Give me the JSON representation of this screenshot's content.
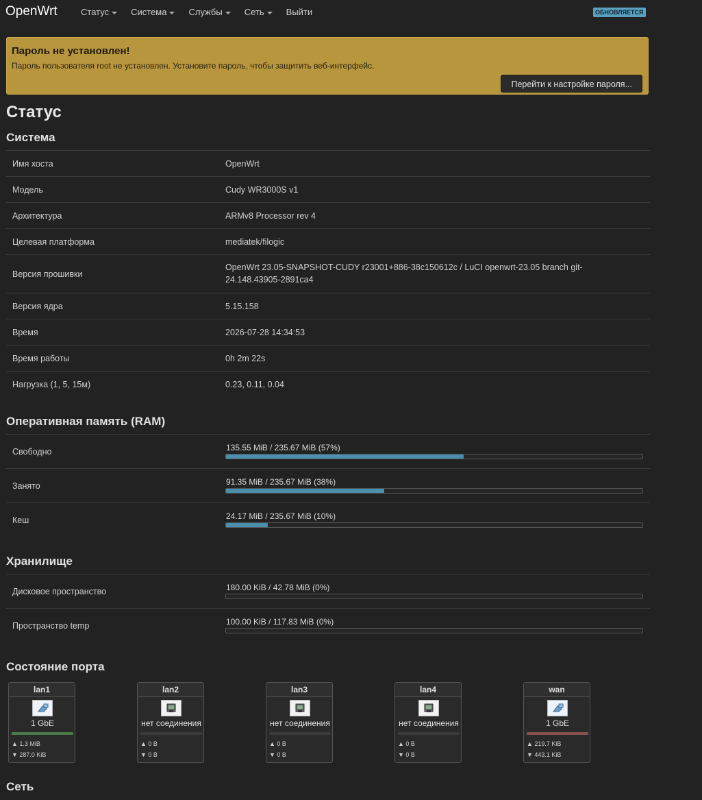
{
  "header": {
    "brand": "OpenWrt",
    "nav": [
      "Статус",
      "Система",
      "Службы",
      "Сеть",
      "Выйти"
    ],
    "badge": "ОБНОВЛЯЕТСЯ"
  },
  "alert": {
    "title": "Пароль не установлен!",
    "text": "Пароль пользователя root не установлен. Установите пароль, чтобы защитить веб-интерфейс.",
    "button": "Перейти к настройке пароля..."
  },
  "page_title": "Статус",
  "system": {
    "title": "Система",
    "rows": [
      {
        "k": "Имя хоста",
        "v": "OpenWrt"
      },
      {
        "k": "Модель",
        "v": "Cudy WR3000S v1"
      },
      {
        "k": "Архитектура",
        "v": "ARMv8 Processor rev 4"
      },
      {
        "k": "Целевая платформа",
        "v": "mediatek/filogic"
      },
      {
        "k": "Версия прошивки",
        "v": "OpenWrt 23.05-SNAPSHOT-CUDY r23001+886-38c150612c / LuCI openwrt-23.05 branch git-24.148.43905-2891ca4"
      },
      {
        "k": "Версия ядра",
        "v": "5.15.158"
      },
      {
        "k": "Время",
        "v": "2026-07-28 14:34:53"
      },
      {
        "k": "Время работы",
        "v": "0h 2m 22s"
      },
      {
        "k": "Нагрузка (1, 5, 15м)",
        "v": "0.23, 0.11, 0.04"
      }
    ]
  },
  "ram": {
    "title": "Оперативная память (RAM)",
    "rows": [
      {
        "k": "Свободно",
        "label": "135.55 MiB / 235.67 MiB (57%)",
        "pct": 57
      },
      {
        "k": "Занято",
        "label": "91.35 MiB / 235.67 MiB (38%)",
        "pct": 38
      },
      {
        "k": "Кеш",
        "label": "24.17 MiB / 235.67 MiB (10%)",
        "pct": 10
      }
    ]
  },
  "storage": {
    "title": "Хранилище",
    "rows": [
      {
        "k": "Дисковое пространство",
        "label": "180.00 KiB / 42.78 MiB (0%)",
        "pct": 0
      },
      {
        "k": "Пространство temp",
        "label": "100.00 KiB / 117.83 MiB (0%)",
        "pct": 0
      }
    ]
  },
  "ports": {
    "title": "Состояние порта",
    "items": [
      {
        "name": "lan1",
        "speed": "1 GbE",
        "tx": "▲ 1.3 MiB",
        "rx": "▼ 287.0 KiB",
        "up": true,
        "color": "#4a7a4a"
      },
      {
        "name": "lan2",
        "speed": "нет соединения",
        "tx": "▲ 0 B",
        "rx": "▼ 0 B",
        "up": false,
        "color": "#3a3a3a"
      },
      {
        "name": "lan3",
        "speed": "нет соединения",
        "tx": "▲ 0 B",
        "rx": "▼ 0 B",
        "up": false,
        "color": "#3a3a3a"
      },
      {
        "name": "lan4",
        "speed": "нет соединения",
        "tx": "▲ 0 B",
        "rx": "▼ 0 B",
        "up": false,
        "color": "#3a3a3a"
      },
      {
        "name": "wan",
        "speed": "1 GbE",
        "tx": "▲ 219.7 KiB",
        "rx": "▼ 443.1 KiB",
        "up": true,
        "color": "#8a5050"
      }
    ]
  },
  "network": {
    "title": "Сеть"
  }
}
